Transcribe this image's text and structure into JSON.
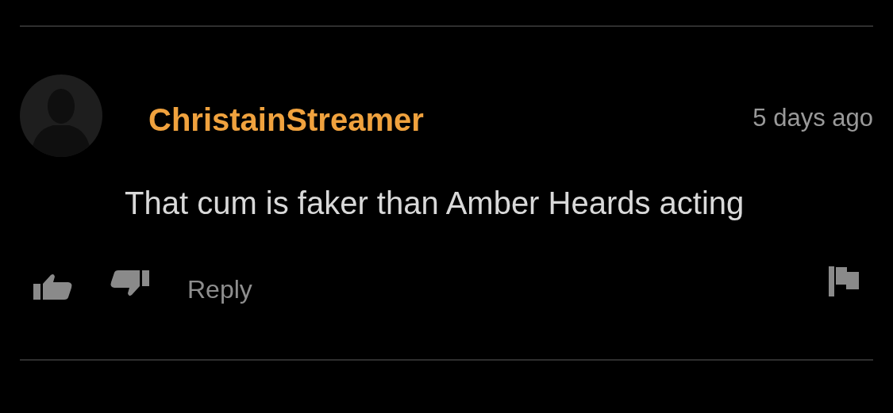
{
  "comment": {
    "username": "ChristainStreamer",
    "time": "5 days ago",
    "text": "That cum is faker than Amber Heards acting",
    "reply": "Reply"
  }
}
